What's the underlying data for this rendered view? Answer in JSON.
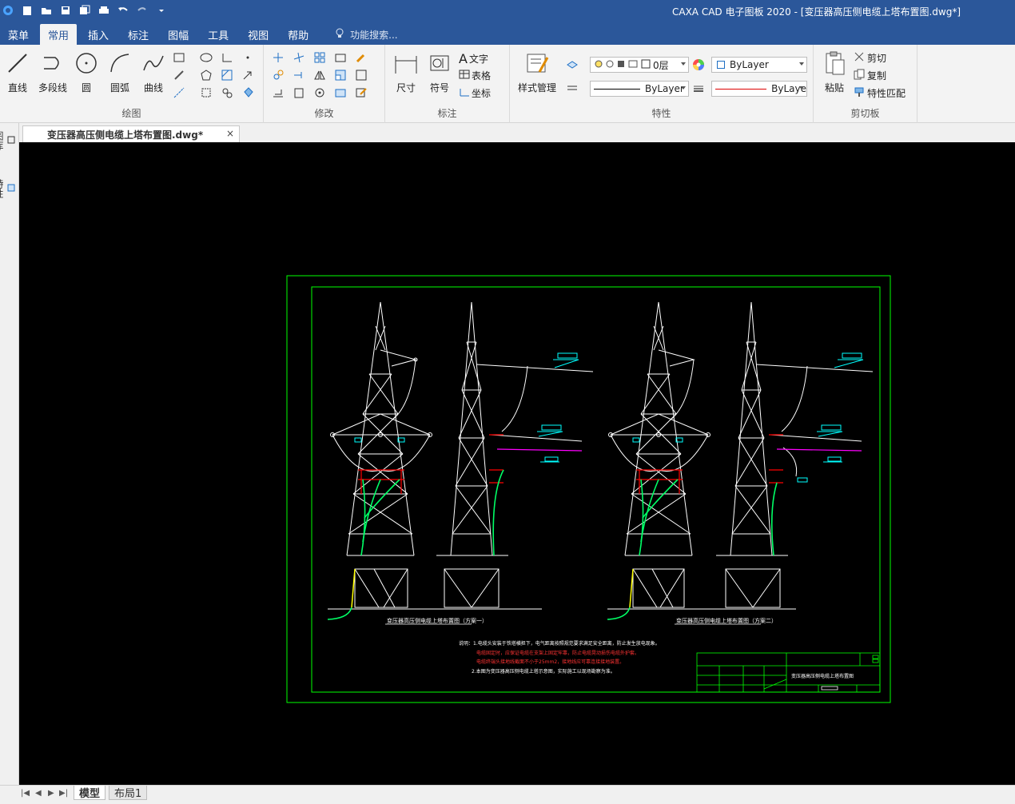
{
  "app_title": "CAXA CAD 电子图板 2020 - [变压器高压侧电缆上塔布置图.dwg*]",
  "quick_access": [
    "new-icon",
    "open-icon",
    "save-icon",
    "save-all-icon",
    "print-icon",
    "undo-icon",
    "redo-icon",
    "customize-icon"
  ],
  "menu": {
    "items": [
      "菜单",
      "常用",
      "插入",
      "标注",
      "图幅",
      "工具",
      "视图",
      "帮助"
    ],
    "active": "常用",
    "search_placeholder": "功能搜索..."
  },
  "ribbon": {
    "groups": {
      "draw": "绘图",
      "modify": "修改",
      "annotate": "标注",
      "properties": "特性",
      "clipboard": "剪切板"
    },
    "draw_tools": [
      "直线",
      "多段线",
      "圆",
      "圆弧",
      "曲线"
    ],
    "annotate_tools": {
      "dimension": "尺寸",
      "symbol": "符号",
      "text": "文字",
      "table": "表格",
      "coordinate": "坐标"
    },
    "style_manage": "样式管理",
    "layer_value": "0层",
    "color_value": "ByLayer",
    "linetype_value": "ByLayer",
    "lineweight_value": "ByLaye",
    "clipboard_tools": {
      "paste": "粘贴",
      "cut": "剪切",
      "copy": "复制",
      "match": "特性匹配"
    }
  },
  "document_tab": {
    "label": "变压器高压侧电缆上塔布置图.dwg*",
    "close": "×"
  },
  "side_panel": {
    "tabs": [
      "图库",
      "特性"
    ]
  },
  "layout_tabs": {
    "items": [
      "模型",
      "布局1"
    ],
    "active": "模型"
  },
  "drawing": {
    "note_heading": "说明：1.电缆头安装于铁塔横担下，电气距离按照规范要求满足安全距离，防止发生放电现象。",
    "note_red_1": "电缆固定时，应保证电缆在支架上固定牢靠，防止电缆晃动损伤电缆外护套。",
    "note_red_2": "电缆终端头接地线截面不小于25mm2，接地线应可靠连接接地装置。",
    "note_2": "2.本图为变压器高压侧电缆上塔示意图，实际施工以现场勘察为准。",
    "caption_left": "变压器高压侧电缆上塔布置图（方案一）",
    "caption_right": "变压器高压侧电缆上塔布置图（方案二）",
    "title_block_name": "变压器高压侧电缆上塔布置图",
    "colors": {
      "frame": "#00ff00",
      "structure": "#ffffff",
      "cable": "#ff00ff",
      "label": "#00ffff",
      "red": "#ff0000",
      "yellow": "#ffff00",
      "green_cable": "#00ff66"
    }
  }
}
